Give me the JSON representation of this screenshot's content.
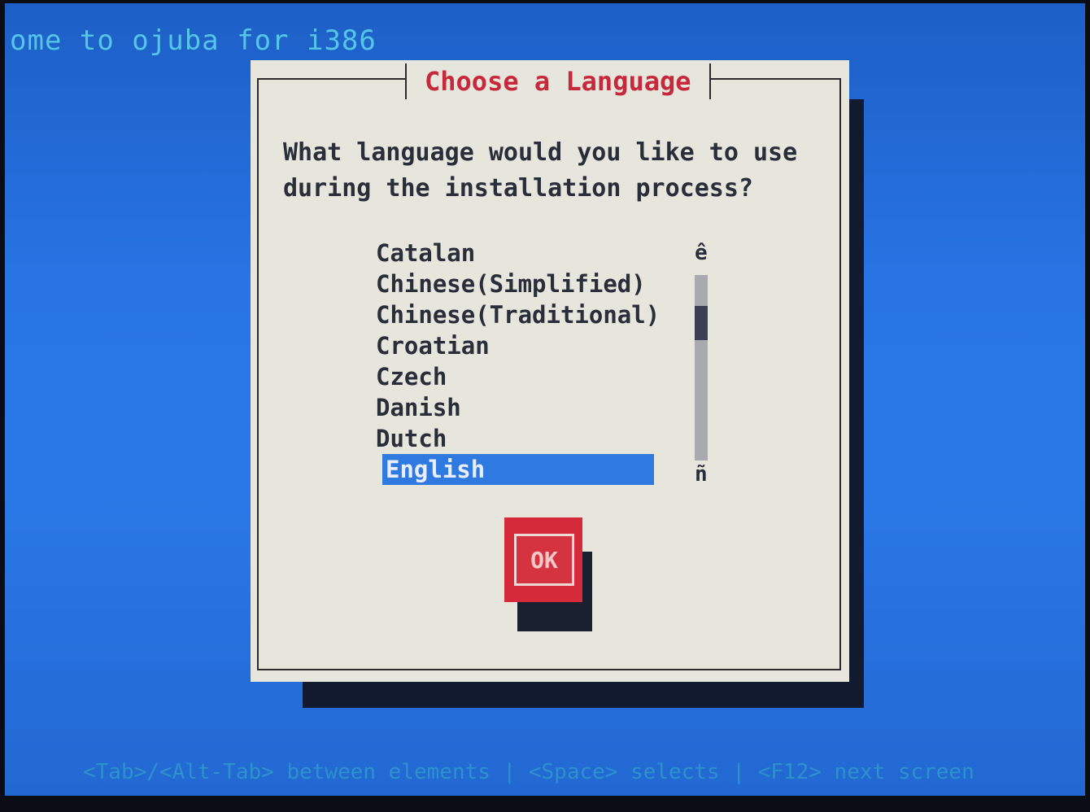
{
  "screen": {
    "welcome_text": "ome to ojuba for i386"
  },
  "dialog": {
    "title": "Choose a Language",
    "question": "What language would you like to use during the installation process?",
    "languages": [
      "Catalan",
      "Chinese(Simplified)",
      "Chinese(Traditional)",
      "Croatian",
      "Czech",
      "Danish",
      "Dutch",
      "English"
    ],
    "selected_language": "English",
    "scroll_up_glyph": "ê",
    "scroll_down_glyph": "ñ",
    "ok_label": "OK"
  },
  "footer": {
    "help_text": "<Tab>/<Alt-Tab> between elements  | <Space> selects | <F12> next screen"
  },
  "colors": {
    "background": "#2a78e8",
    "dialog": "#e6e6dc",
    "title": "#c8283c",
    "selection": "#2f7ae0",
    "button": "#d52a3a"
  }
}
